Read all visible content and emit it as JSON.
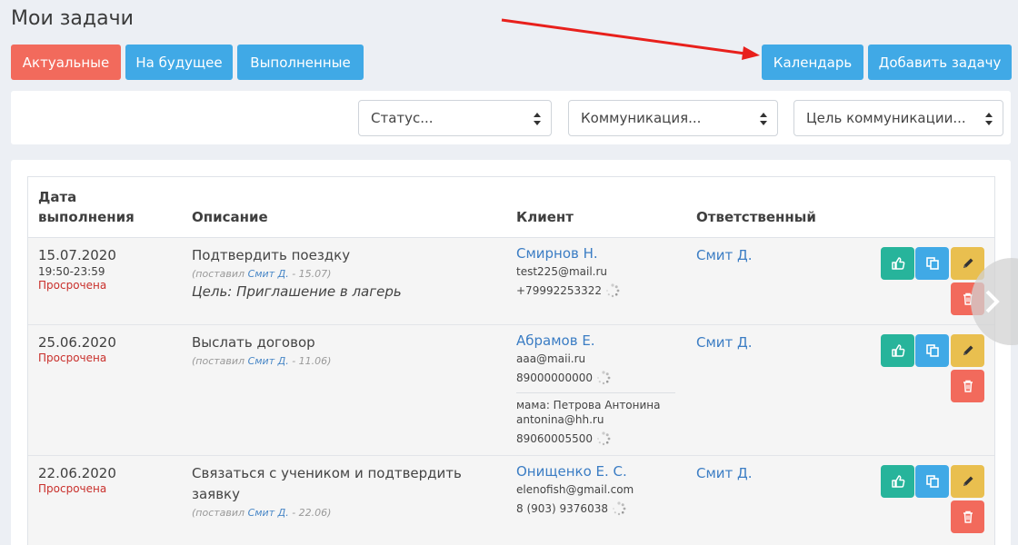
{
  "page": {
    "title": "Мои задачи"
  },
  "tabs": [
    {
      "label": "Актуальные",
      "active": true
    },
    {
      "label": "На будущее"
    },
    {
      "label": "Выполненные"
    }
  ],
  "actions": {
    "calendar": "Календарь",
    "add_task": "Добавить задачу"
  },
  "filters": [
    {
      "value": "Статус..."
    },
    {
      "value": "Коммуникация..."
    },
    {
      "value": "Цель коммуникации..."
    }
  ],
  "table": {
    "headers": {
      "date_line1": "Дата",
      "date_line2": "выполнения",
      "description": "Описание",
      "client": "Клиент",
      "responsible": "Ответственный"
    },
    "rows": [
      {
        "date": "15.07.2020",
        "time": "19:50-23:59",
        "status": "Просрочена",
        "description": "Подтвердить поездку",
        "meta_prefix": "(поставил ",
        "meta_author": "Смит Д.",
        "meta_suffix": " - 15.07)",
        "goal": "Цель: Приглашение в лагерь",
        "client_name": "Смирнов Н.",
        "client_email": "test225@mail.ru",
        "client_phone": "+79992253322",
        "responsible": "Смит Д."
      },
      {
        "date": "25.06.2020",
        "status": "Просрочена",
        "description": "Выслать договор",
        "meta_prefix": "(поставил ",
        "meta_author": "Смит Д.",
        "meta_suffix": " - 11.06)",
        "client_name": "Абрамов Е.",
        "client_email": "aaa@maii.ru",
        "client_phone": "89000000000",
        "relative_label": "мама: Петрова Антонина",
        "relative_email": "antonina@hh.ru",
        "relative_phone": "89060005500",
        "responsible": "Смит Д."
      },
      {
        "date": "22.06.2020",
        "status": "Просрочена",
        "description_line1": "Связаться с учеником и подтвердить",
        "description_line2": "заявку",
        "meta_prefix": "(поставил ",
        "meta_author": "Смит Д.",
        "meta_suffix": " - 22.06)",
        "client_name": "Онищенко Е. С.",
        "client_email": "elenofish@gmail.com",
        "client_phone": "8 (903) 9376038",
        "responsible": "Смит Д."
      }
    ]
  },
  "icons": {
    "complete": "thumbs-up-icon",
    "copy": "copy-icon",
    "edit": "pencil-icon",
    "delete": "trash-icon",
    "next": "chevron-right-icon",
    "loading": "spinner-icon"
  },
  "colors": {
    "active_tab": "#f26a5c",
    "primary": "#40a9e6",
    "complete": "#27b49b",
    "edit": "#e9bf4f",
    "delete": "#f26a5c",
    "overdue_text": "#c9302c",
    "link": "#3b7dc4",
    "annotation_arrow": "#e8201c"
  }
}
